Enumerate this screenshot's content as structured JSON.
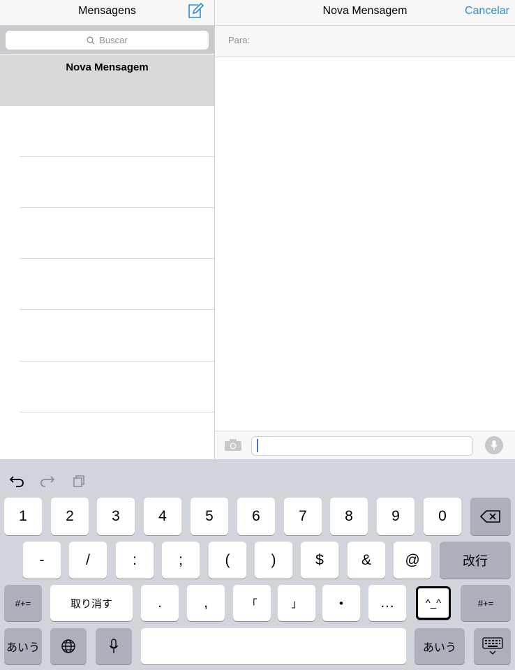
{
  "left": {
    "title": "Mensagens",
    "search_placeholder": "Buscar",
    "selected_item": "Nova Mensagem"
  },
  "right": {
    "title": "Nova Mensagem",
    "cancel": "Cancelar",
    "to_label": "Para:"
  },
  "keyboard": {
    "row1": [
      "1",
      "2",
      "3",
      "4",
      "5",
      "6",
      "7",
      "8",
      "9",
      "0"
    ],
    "row2": [
      "-",
      "/",
      ":",
      ";",
      "(",
      ")",
      "$",
      "&",
      "@"
    ],
    "enter": "改行",
    "symbols": "#+=",
    "undo": "取り消す",
    "row3": [
      ".",
      ",",
      "「",
      "」",
      "・",
      "…"
    ],
    "emoticon": "^_^",
    "kana": "あいう",
    "toolbar_icons": [
      "undo-icon",
      "redo-icon",
      "paste-icon"
    ]
  }
}
